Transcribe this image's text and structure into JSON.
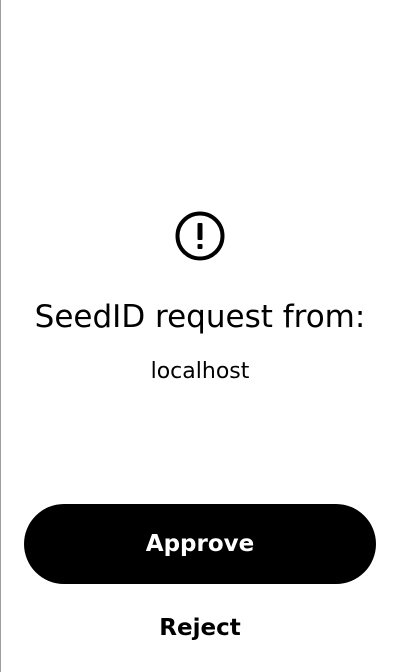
{
  "request": {
    "icon": "alert-circle-icon",
    "title": "SeedID request from:",
    "origin": "localhost"
  },
  "actions": {
    "approve_label": "Approve",
    "reject_label": "Reject"
  },
  "colors": {
    "primary_button_bg": "#000000",
    "primary_button_text": "#ffffff",
    "background": "#ffffff",
    "text": "#000000"
  }
}
